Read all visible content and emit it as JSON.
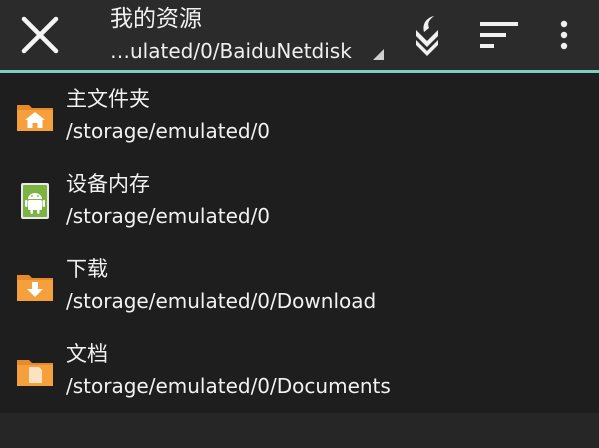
{
  "header": {
    "title": "我的资源",
    "current_path": "…ulated/0/BaiduNetdisk",
    "accent_color": "#7fcfc0"
  },
  "toolbar": {
    "close_icon": "close-icon",
    "bookmark_icon": "bookmark-down-icon",
    "sort_icon": "sort-icon",
    "more_icon": "more-vert-icon"
  },
  "locations": [
    {
      "name": "主文件夹",
      "path": "/storage/emulated/0",
      "icon": "home-folder-icon",
      "color": "#f39c34"
    },
    {
      "name": "设备内存",
      "path": "/storage/emulated/0",
      "icon": "android-storage-icon",
      "color": "#8bc34a"
    },
    {
      "name": "下载",
      "path": "/storage/emulated/0/Download",
      "icon": "download-folder-icon",
      "color": "#f39c34"
    },
    {
      "name": "文档",
      "path": "/storage/emulated/0/Documents",
      "icon": "documents-folder-icon",
      "color": "#f39c34"
    }
  ]
}
